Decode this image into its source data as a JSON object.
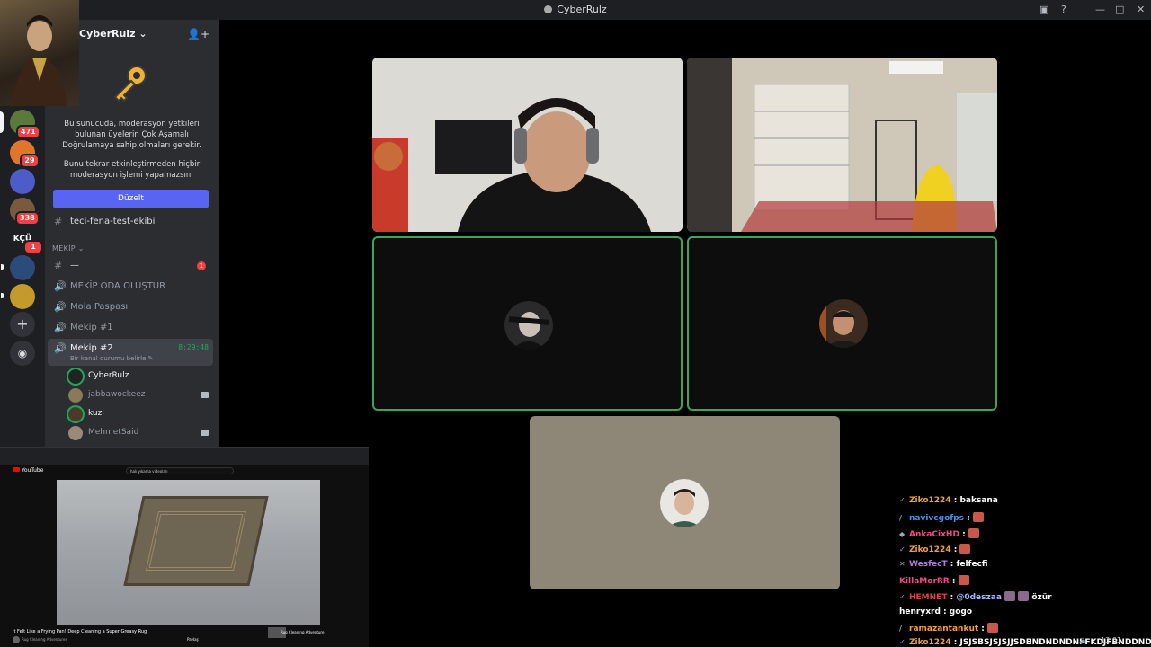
{
  "window": {
    "title": "CyberRulz"
  },
  "server": {
    "name": "CyberRulz"
  },
  "colors": {
    "accent": "#5865f2",
    "speaking": "#23a559",
    "mention": "#f23f43"
  },
  "servers": [
    {
      "badge": "471"
    },
    {
      "badge": "29"
    },
    {
      "badge": ""
    },
    {
      "badge": "338"
    },
    {
      "label": "KÇÜ",
      "badge": "1"
    },
    {
      "badge": ""
    },
    {
      "badge": ""
    }
  ],
  "mfa": {
    "line1": "Bu sunucuda, moderasyon yetkileri bulunan üyelerin Çok Aşamalı Doğrulamaya sahip olmaları gerekir.",
    "line2": "Bunu tekrar etkinleştirmeden hiçbir moderasyon işlemi yapamazsın.",
    "button": "Düzelt"
  },
  "channels": {
    "text1": "teci-fena-test-ekibi",
    "category": "MEKİP",
    "text2": "—",
    "text2_mentions": "1",
    "voice": [
      "MEKİP ODA OLUŞTUR",
      "Mola Paspası",
      "Mekip #1"
    ],
    "active": {
      "name": "Mekip #2",
      "timer": "8:29:48",
      "status": "Bir kanal durumu belirle"
    },
    "users": [
      {
        "name": "CyberRulz"
      },
      {
        "name": "jabbawockeez"
      },
      {
        "name": "kuzi"
      },
      {
        "name": "MehmetSaid"
      }
    ]
  },
  "pip": {
    "search": "halı yıkama videoları",
    "video_title": "It Felt Like a Frying Pan! Deep Cleaning a Super Greasy Rug",
    "channel": "Rug Cleaning Adventures",
    "actions": "Paylaş",
    "side_title": "Rug Cleaning Adventure"
  },
  "chat": [
    {
      "user": "Ziko1224",
      "color": "#f0a040",
      "text": "baksana",
      "emote": false
    },
    {
      "user": "navivcgofps",
      "color": "#4a90e2",
      "text": "",
      "emote": true
    },
    {
      "user": "AnkaCixHD",
      "color": "#f04a8c",
      "text": "",
      "emote": true
    },
    {
      "user": "Ziko1224",
      "color": "#f0a040",
      "text": "",
      "emote": true
    },
    {
      "user": "WesfecT",
      "color": "#b07ae0",
      "text": "felfecfi",
      "emote": false
    },
    {
      "user": "KillaMorRR",
      "color": "#f04a8c",
      "text": "",
      "emote": true
    },
    {
      "user": "HEMNET",
      "color": "#e04040",
      "text": "@0deszaa",
      "text2": "özür",
      "emote": false
    },
    {
      "user": "henryxrd",
      "color": "#ffffff",
      "text": "gogo",
      "emote": false
    },
    {
      "user": "ramazantankut",
      "color": "#f0a040",
      "text": "",
      "emote": true
    },
    {
      "user": "Ziko1224",
      "color": "#f0a040",
      "text": "JSJSBSJSJSJJSDBNDNDNDNFFKDJFBNDDNDKD",
      "emote": false
    }
  ],
  "tray": {
    "time": "13:01"
  }
}
